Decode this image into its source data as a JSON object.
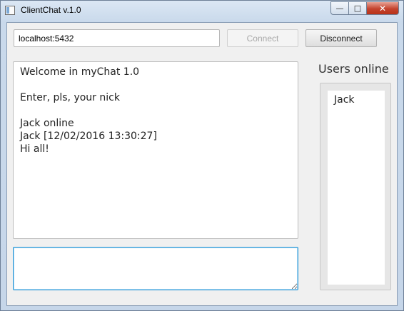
{
  "window": {
    "title": "ClientChat v.1.0",
    "buttons": {
      "minimize": "—",
      "maximize": "□",
      "close": "✕"
    }
  },
  "connection": {
    "host_value": "localhost:5432",
    "connect_label": "Connect",
    "disconnect_label": "Disconnect"
  },
  "chat": {
    "messages": "Welcome in myChat 1.0\n\nEnter, pls, your nick\n\nJack online\nJack [12/02/2016 13:30:27]\nHi all!",
    "input_value": ""
  },
  "users": {
    "title": "Users online",
    "list": [
      "Jack"
    ]
  },
  "colors": {
    "focus_border": "#2b99d6",
    "close_button": "#c4432e"
  }
}
